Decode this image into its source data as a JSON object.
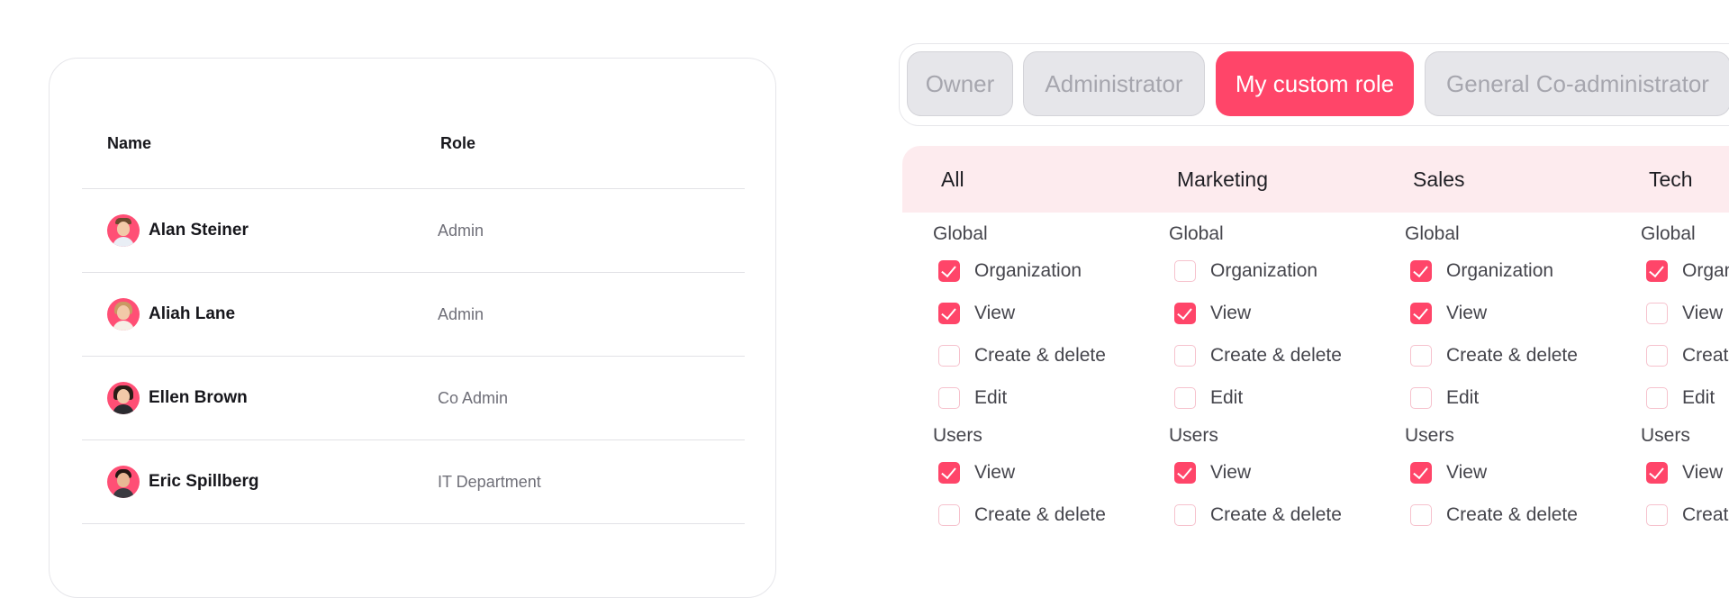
{
  "users_table": {
    "header": {
      "name": "Name",
      "role": "Role"
    },
    "rows": [
      {
        "name": "Alan Steiner",
        "role": "Admin",
        "avatar": "avatar-alan"
      },
      {
        "name": "Aliah Lane",
        "role": "Admin",
        "avatar": "avatar-aliah"
      },
      {
        "name": "Ellen Brown",
        "role": "Co Admin",
        "avatar": "avatar-ellen"
      },
      {
        "name": "Eric Spillberg",
        "role": "IT Department",
        "avatar": "avatar-eric"
      }
    ]
  },
  "role_tabs": [
    {
      "label": "Owner",
      "active": false
    },
    {
      "label": "Administrator",
      "active": false
    },
    {
      "label": "My custom role",
      "active": true
    },
    {
      "label": "General Co-administrator",
      "active": false
    }
  ],
  "permissions": {
    "columns": [
      {
        "title": "All",
        "groups": [
          {
            "label": "Global",
            "items": [
              {
                "label": "Organization",
                "checked": true
              },
              {
                "label": "View",
                "checked": true
              },
              {
                "label": "Create & delete",
                "checked": false
              },
              {
                "label": "Edit",
                "checked": false
              }
            ]
          },
          {
            "label": "Users",
            "items": [
              {
                "label": "View",
                "checked": true
              },
              {
                "label": "Create & delete",
                "checked": false
              }
            ]
          }
        ]
      },
      {
        "title": "Marketing",
        "groups": [
          {
            "label": "Global",
            "items": [
              {
                "label": "Organization",
                "checked": false
              },
              {
                "label": "View",
                "checked": true
              },
              {
                "label": "Create & delete",
                "checked": false
              },
              {
                "label": "Edit",
                "checked": false
              }
            ]
          },
          {
            "label": "Users",
            "items": [
              {
                "label": "View",
                "checked": true
              },
              {
                "label": "Create & delete",
                "checked": false
              }
            ]
          }
        ]
      },
      {
        "title": "Sales",
        "groups": [
          {
            "label": "Global",
            "items": [
              {
                "label": "Organization",
                "checked": true
              },
              {
                "label": "View",
                "checked": true
              },
              {
                "label": "Create & delete",
                "checked": false
              },
              {
                "label": "Edit",
                "checked": false
              }
            ]
          },
          {
            "label": "Users",
            "items": [
              {
                "label": "View",
                "checked": true
              },
              {
                "label": "Create & delete",
                "checked": false
              }
            ]
          }
        ]
      },
      {
        "title": "Tech",
        "groups": [
          {
            "label": "Global",
            "items": [
              {
                "label": "Organization",
                "checked": true
              },
              {
                "label": "View",
                "checked": false
              },
              {
                "label": "Create & delete",
                "checked": false
              },
              {
                "label": "Edit",
                "checked": false
              }
            ]
          },
          {
            "label": "Users",
            "items": [
              {
                "label": "View",
                "checked": true
              },
              {
                "label": "Create & delete",
                "checked": false
              }
            ]
          }
        ]
      }
    ]
  },
  "colors": {
    "accent": "#ff4569",
    "header_bg": "#fdebee",
    "tab_inactive_bg": "#e6e6ea"
  }
}
